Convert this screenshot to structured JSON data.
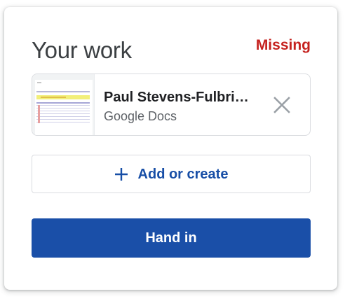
{
  "your_work": {
    "title": "Your work",
    "status": "Missing"
  },
  "attachment": {
    "name": "Paul Stevens-Fulbright",
    "type": "Google Docs",
    "remove_icon": "close-icon"
  },
  "add_button": {
    "icon": "plus-icon",
    "label": "Add or create"
  },
  "hand_in_button": {
    "label": "Hand in"
  },
  "colors": {
    "missing": "#c5221f",
    "accent": "#174ea6",
    "hand_in_bg": "#1a4fa8",
    "title": "#3c4043",
    "border": "#dadce0",
    "icon_grey": "#9aa0a6"
  }
}
